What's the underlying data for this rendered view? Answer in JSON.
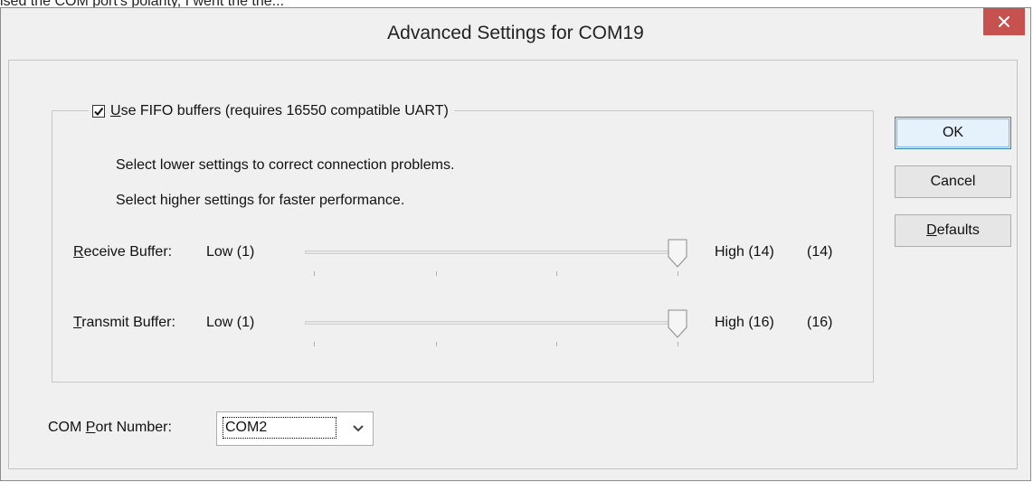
{
  "top_text": "ised the COM port's polarity, I went the the...",
  "window": {
    "title": "Advanced Settings for COM19"
  },
  "fifo": {
    "checked": true,
    "label_prefix": "",
    "label_accel": "U",
    "label_rest": "se FIFO buffers (requires 16550 compatible UART)"
  },
  "info": {
    "line1": "Select lower settings to correct connection problems.",
    "line2": "Select higher settings for faster performance."
  },
  "receive": {
    "label_accel": "R",
    "label_rest": "eceive Buffer:",
    "low": "Low (1)",
    "high": "High (14)",
    "value_text": "(14)",
    "value": 14,
    "min": 1,
    "max": 14
  },
  "transmit": {
    "label_accel": "T",
    "label_rest": "ransmit Buffer:",
    "low": "Low (1)",
    "high": "High (16)",
    "value_text": "(16)",
    "value": 16,
    "min": 1,
    "max": 16
  },
  "com_port": {
    "label_before": "COM ",
    "label_accel": "P",
    "label_after": "ort Number:",
    "selected": "COM2"
  },
  "buttons": {
    "ok": "OK",
    "cancel": "Cancel",
    "defaults_accel": "D",
    "defaults_rest": "efaults"
  },
  "colors": {
    "close_button": "#c7514f",
    "default_button_border": "#3c7fb1"
  }
}
